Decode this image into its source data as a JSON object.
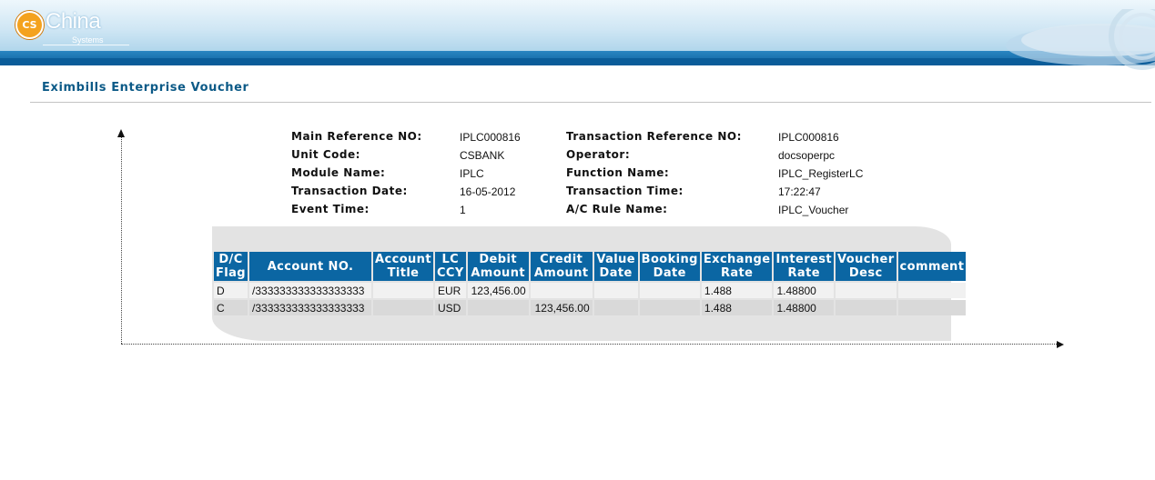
{
  "header": {
    "logo_badge": "CS",
    "logo_name": "China",
    "logo_sub": "Systems"
  },
  "page_title": "Eximbills Enterprise Voucher",
  "info": {
    "main_ref_label": "Main Reference NO:",
    "main_ref_value": "IPLC000816",
    "txn_ref_label": "Transaction Reference NO:",
    "txn_ref_value": "IPLC000816",
    "unit_code_label": "Unit Code:",
    "unit_code_value": "CSBANK",
    "operator_label": "Operator:",
    "operator_value": "docsoperpc",
    "module_label": "Module Name:",
    "module_value": "IPLC",
    "function_label": "Function Name:",
    "function_value": "IPLC_RegisterLC",
    "txn_date_label": "Transaction Date:",
    "txn_date_value": "16-05-2012",
    "txn_time_label": "Transaction Time:",
    "txn_time_value": "17:22:47",
    "event_time_label": "Event Time:",
    "event_time_value": "1",
    "ac_rule_label": "A/C Rule Name:",
    "ac_rule_value": "IPLC_Voucher"
  },
  "table": {
    "headers": [
      [
        "D/C",
        "Flag"
      ],
      [
        "Account NO.",
        ""
      ],
      [
        "Account",
        "Title"
      ],
      [
        "LC",
        "CCY"
      ],
      [
        "Debit",
        "Amount"
      ],
      [
        "Credit",
        "Amount"
      ],
      [
        "Value",
        "Date"
      ],
      [
        "Booking",
        "Date"
      ],
      [
        "Exchange",
        "Rate"
      ],
      [
        "Interest",
        "Rate"
      ],
      [
        "Voucher",
        "Desc"
      ],
      [
        "comment",
        ""
      ]
    ],
    "rows": [
      [
        "D",
        "/333333333333333333",
        "",
        "EUR",
        "123,456.00",
        "",
        "",
        "",
        "1.488",
        "1.48800",
        "",
        ""
      ],
      [
        "C",
        "/333333333333333333",
        "",
        "USD",
        "",
        "123,456.00",
        "",
        "",
        "1.488",
        "1.48800",
        "",
        ""
      ]
    ]
  },
  "colors": {
    "banner_blue": "#0b5f9c",
    "header_cell": "#0b66a3",
    "title_text": "#0c5a87",
    "logo_orange": "#f4a21e"
  }
}
